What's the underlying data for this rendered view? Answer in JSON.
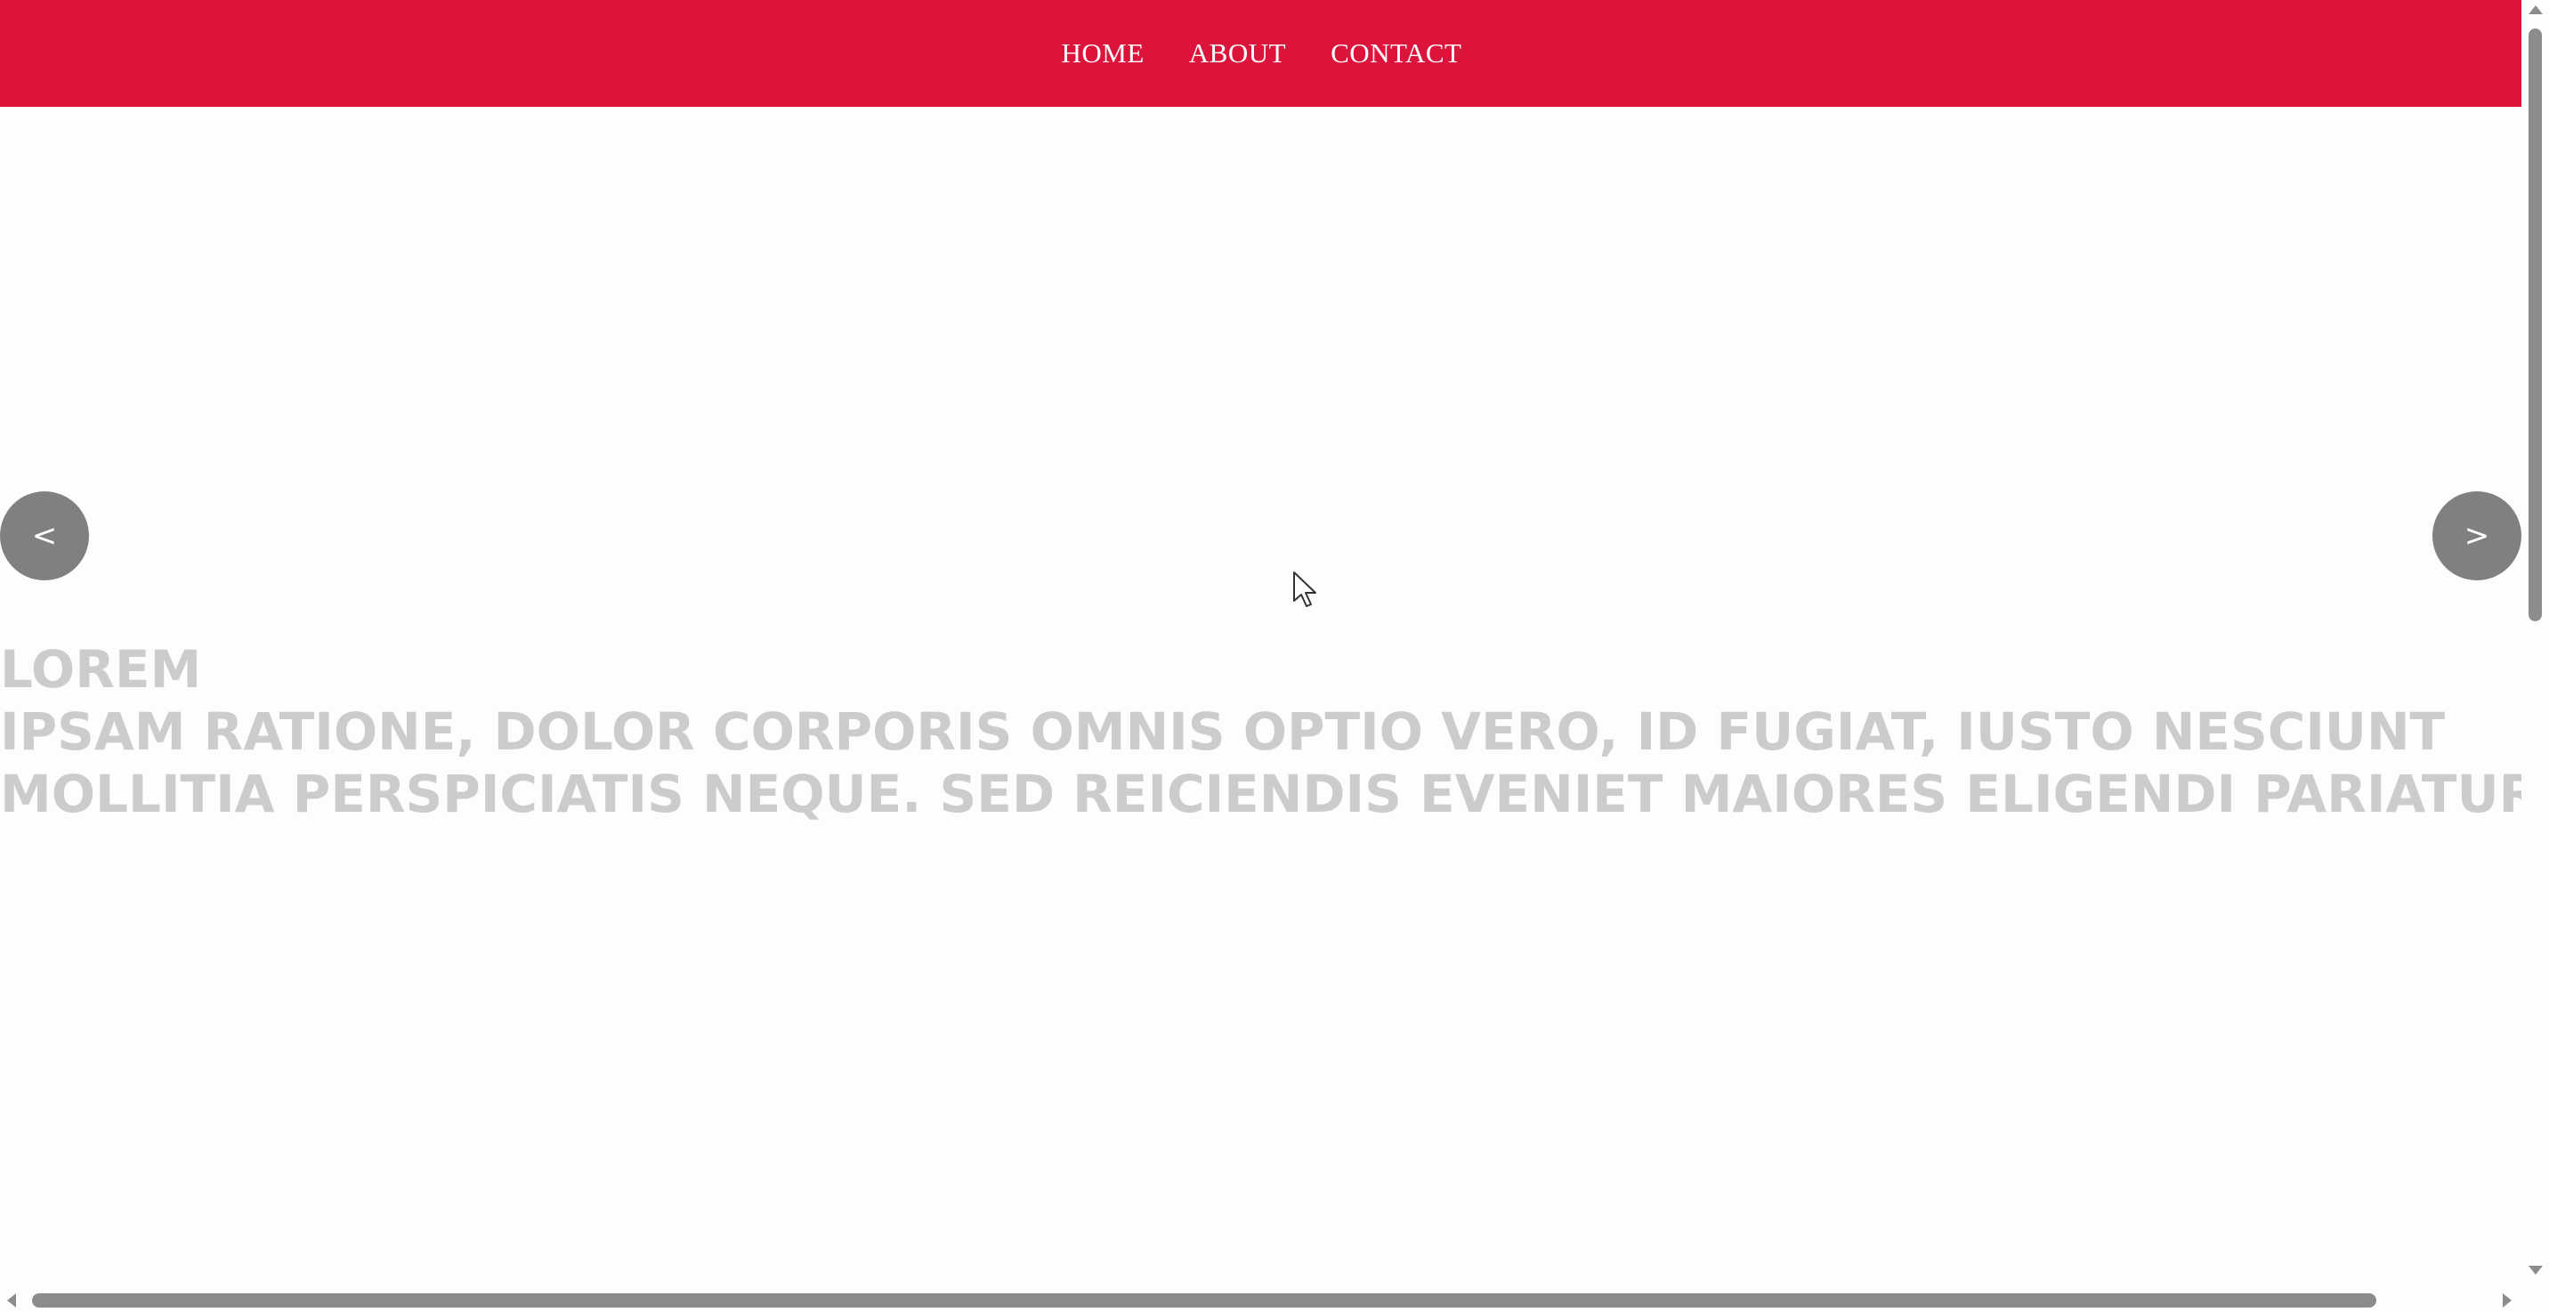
{
  "nav": {
    "links": [
      {
        "label": "HOME"
      },
      {
        "label": "ABOUT"
      },
      {
        "label": "CONTACT"
      }
    ],
    "background_color": "#dc143c",
    "text_color": "#ffffff"
  },
  "slider": {
    "title": "LOREM",
    "body": "IPSAM RATIONE, DOLOR CORPORIS OMNIS OPTIO VERO, ID FUGIAT, IUSTO NESCIUNT MOLLITIA PERSPICIATIS NEQUE. SED REICIENDIS EVENIET MAIORES ELIGENDI PARIATUR",
    "prev_label": "<",
    "next_label": ">",
    "text_color": "#cccccc",
    "button_color": "#808080"
  },
  "icons": {
    "cursor": "mouse-pointer-icon",
    "scroll_up": "arrow-up-icon",
    "scroll_down": "arrow-down-icon",
    "scroll_left": "arrow-left-icon",
    "scroll_right": "arrow-right-icon"
  }
}
